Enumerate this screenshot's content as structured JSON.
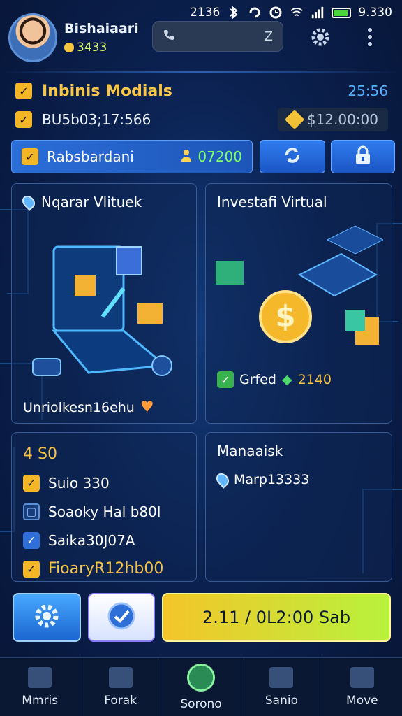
{
  "status": {
    "time": "2136",
    "battery_text": "9.330"
  },
  "header": {
    "username": "Bishaiaari",
    "coins": "3433",
    "search_value": "Z"
  },
  "info": {
    "title": "Inbinis Modials",
    "time": "25:56",
    "code": "BU5b03;17:566",
    "balance": "$12.00:00"
  },
  "action": {
    "label": "Rabsbardani",
    "amount": "07200"
  },
  "cards": {
    "left_top": {
      "title": "Nqarar Vlituek",
      "footer": "Unriolkesn16ehu"
    },
    "right_top": {
      "title": "Investafi Virtual",
      "footer_label": "Grfed",
      "footer_value": "2140"
    },
    "left_bottom": {
      "items": [
        {
          "label": "4 S0"
        },
        {
          "label": "Suio 330"
        },
        {
          "label": "Soaoky Hal b80l"
        },
        {
          "label": "Saika30J07A"
        },
        {
          "label": "FioaryR12hb00"
        }
      ]
    },
    "right_bottom": {
      "title": "Manaaisk",
      "item": "Marp13333"
    }
  },
  "main_button": {
    "label": "2.11 / 0L2:00 Sab"
  },
  "nav": [
    {
      "label": "Mmris"
    },
    {
      "label": "Forak"
    },
    {
      "label": "Sorono"
    },
    {
      "label": "Sanio"
    },
    {
      "label": "Move"
    }
  ],
  "colors": {
    "accent_yellow": "#f6c64a",
    "accent_blue": "#2f7df0",
    "accent_green": "#7dff6a",
    "background": "#0b2150"
  },
  "icons": [
    "bluetooth-icon",
    "wifi-icon",
    "signal-icon",
    "battery-icon",
    "gear-icon",
    "more-icon",
    "refresh-icon",
    "lock-icon",
    "check-icon",
    "pin-icon",
    "heart-icon",
    "home-icon",
    "calendar-icon",
    "globe-icon",
    "folder-icon",
    "chat-icon"
  ]
}
